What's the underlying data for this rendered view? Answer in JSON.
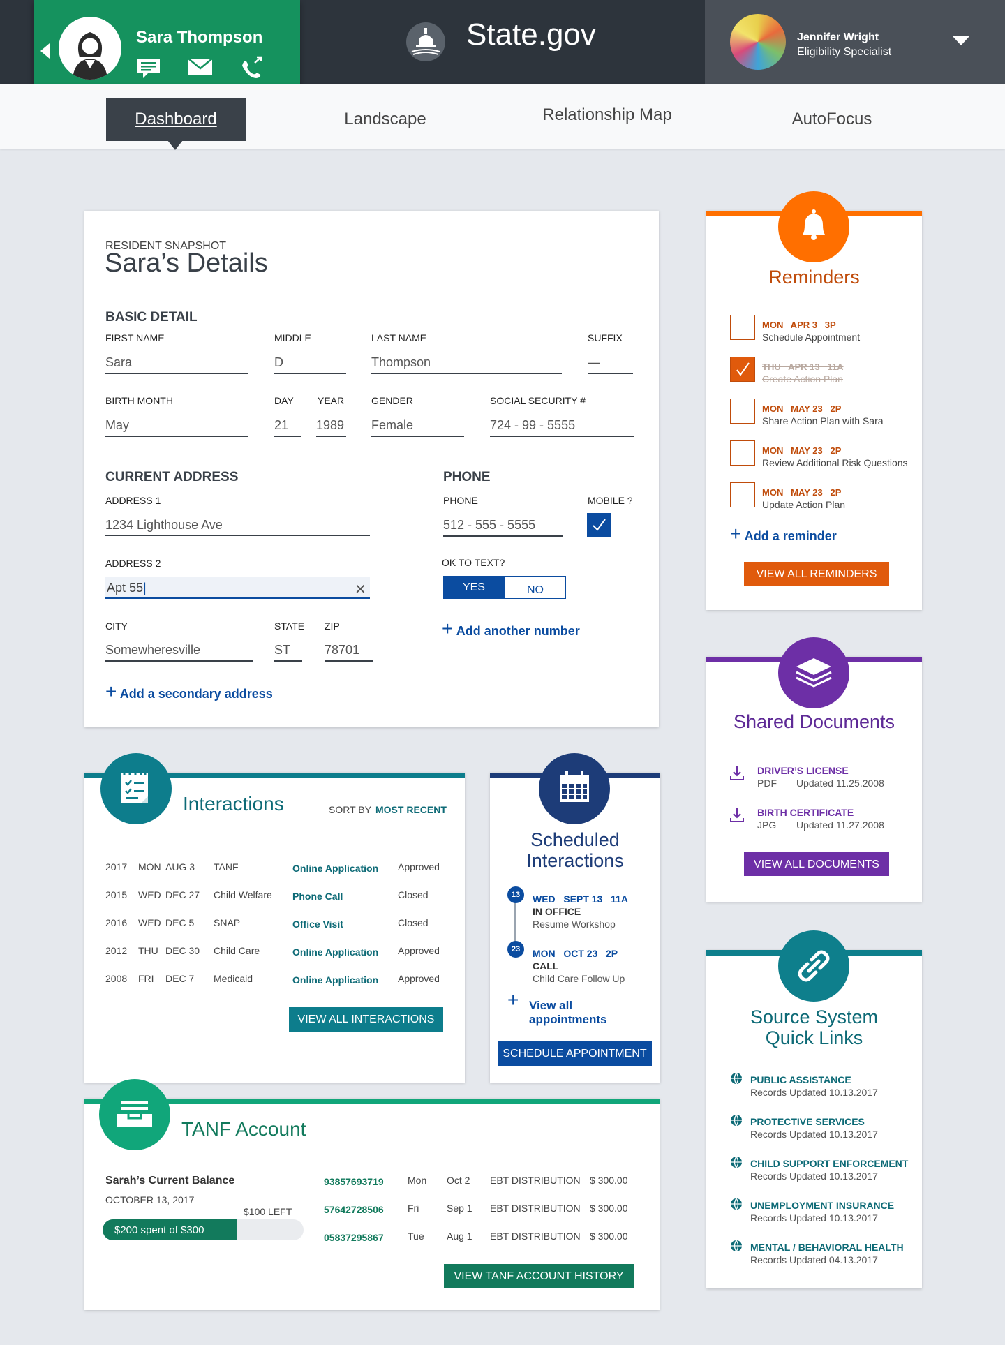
{
  "header": {
    "resident_name": "Sara Thompson",
    "brand": "State.gov",
    "user_name": "Jennifer Wright",
    "user_role": "Eligibility Specialist",
    "colors": {
      "bar": "#2d343c",
      "resident": "#15925e"
    }
  },
  "nav": {
    "tabs": [
      "Dashboard",
      "Landscape",
      "Relationship Map",
      "AutoFocus"
    ],
    "active": "Dashboard"
  },
  "details": {
    "eyebrow": "RESIDENT SNAPSHOT",
    "title": "Sara’s Details",
    "basic_heading": "BASIC DETAIL",
    "first_label": "FIRST NAME",
    "first": "Sara",
    "middle_label": "MIDDLE",
    "middle": "D",
    "last_label": "LAST NAME",
    "last": "Thompson",
    "suffix_label": "SUFFIX",
    "suffix": "—",
    "bmonth_label": "BIRTH MONTH",
    "bmonth": "May",
    "day_label": "DAY",
    "day": "21",
    "year_label": "YEAR",
    "year": "1989",
    "gender_label": "GENDER",
    "gender": "Female",
    "ssn_label": "SOCIAL SECURITY #",
    "ssn": "724 - 99 - 5555",
    "addr_heading": "CURRENT ADDRESS",
    "addr1_label": "ADDRESS 1",
    "addr1": "1234 Lighthouse Ave",
    "addr2_label": "ADDRESS 2",
    "addr2": "Apt 55",
    "city_label": "CITY",
    "city": "Somewheresville",
    "state_label": "STATE",
    "state": "ST",
    "zip_label": "ZIP",
    "zip": "78701",
    "add_address": "Add a secondary address",
    "phone_heading": "PHONE",
    "phone_label": "PHONE",
    "phone": "512 - 555 - 5555",
    "mobile_label": "MOBILE ?",
    "ok_text_label": "OK TO TEXT?",
    "yes": "YES",
    "no": "NO",
    "add_number": "Add another number"
  },
  "interactions": {
    "title": "Interactions",
    "sort_label": "SORT BY",
    "sort_value": "MOST RECENT",
    "rows": [
      {
        "year": "2017",
        "day": "MON",
        "date": "AUG 3",
        "program": "TANF",
        "type": "Online Application",
        "status": "Approved"
      },
      {
        "year": "2015",
        "day": "WED",
        "date": "DEC 27",
        "program": "Child Welfare",
        "type": "Phone Call",
        "status": "Closed"
      },
      {
        "year": "2016",
        "day": "WED",
        "date": "DEC 5",
        "program": "SNAP",
        "type": "Office Visit",
        "status": "Closed"
      },
      {
        "year": "2012",
        "day": "THU",
        "date": "DEC 30",
        "program": "Child Care",
        "type": "Online Application",
        "status": "Approved"
      },
      {
        "year": "2008",
        "day": "FRI",
        "date": "DEC 7",
        "program": "Medicaid",
        "type": "Online Application",
        "status": "Approved"
      }
    ],
    "button": "VIEW ALL INTERACTIONS",
    "color": "#0d7d8c"
  },
  "scheduled": {
    "title_1": "Scheduled",
    "title_2": "Interactions",
    "items": [
      {
        "badge": "13",
        "when": "WED   SEPT 13   11A",
        "type": "IN OFFICE",
        "desc": "Resume Workshop"
      },
      {
        "badge": "23",
        "when": "MON   OCT 23   2P",
        "type": "CALL",
        "desc": "Child Care Follow Up"
      }
    ],
    "view_all_1": "View all",
    "view_all_2": "appointments",
    "button": "SCHEDULE APPOINTMENT",
    "color": "#1d3c78"
  },
  "tanf": {
    "title": "TANF Account",
    "balance_label": "Sarah’s Current Balance",
    "date": "OCTOBER 13, 2017",
    "left": "$100 LEFT",
    "spent": "$200 spent of $300",
    "spent_fraction": 0.667,
    "rows": [
      {
        "id": "93857693719",
        "day": "Mon",
        "date": "Oct 2",
        "type": "EBT DISTRIBUTION",
        "amount": "$ 300.00"
      },
      {
        "id": "57642728506",
        "day": "Fri",
        "date": "Sep 1",
        "type": "EBT DISTRIBUTION",
        "amount": "$ 300.00"
      },
      {
        "id": "05837295867",
        "day": "Tue",
        "date": "Aug 1",
        "type": "EBT DISTRIBUTION",
        "amount": "$ 300.00"
      }
    ],
    "button": "VIEW TANF ACCOUNT HISTORY",
    "color": "#11a67a"
  },
  "reminders": {
    "title": "Reminders",
    "items": [
      {
        "when": "MON   APR 3   3P",
        "text": "Schedule Appointment",
        "done": false
      },
      {
        "when": "THU   APR 13   11A",
        "text": "Create Action Plan",
        "done": true
      },
      {
        "when": "MON   MAY 23   2P",
        "text": "Share Action Plan with Sara",
        "done": false
      },
      {
        "when": "MON   MAY 23   2P",
        "text": "Review Additional Risk Questions",
        "done": false
      },
      {
        "when": "MON   MAY 23   2P",
        "text": "Update Action Plan",
        "done": false
      }
    ],
    "add": "Add a reminder",
    "button": "VIEW ALL REMINDERS",
    "color": "#ff6f00"
  },
  "documents": {
    "title": "Shared Documents",
    "items": [
      {
        "name": "DRIVER’S LICENSE",
        "format": "PDF",
        "updated": "Updated 11.25.2008"
      },
      {
        "name": "BIRTH CERTIFICATE",
        "format": "JPG",
        "updated": "Updated 11.27.2008"
      }
    ],
    "button": "VIEW ALL DOCUMENTS",
    "color": "#6d2fa6"
  },
  "sources": {
    "title_1": "Source System",
    "title_2": "Quick Links",
    "items": [
      {
        "name": "PUBLIC ASSISTANCE",
        "updated": "Records Updated 10.13.2017"
      },
      {
        "name": "PROTECTIVE SERVICES",
        "updated": "Records Updated 10.13.2017"
      },
      {
        "name": "CHILD SUPPORT ENFORCEMENT",
        "updated": "Records Updated 10.13.2017"
      },
      {
        "name": "UNEMPLOYMENT INSURANCE",
        "updated": "Records Updated 10.13.2017"
      },
      {
        "name": "MENTAL / BEHAVIORAL HEALTH",
        "updated": "Records Updated 04.13.2017"
      }
    ],
    "color": "#0e7f8c"
  }
}
